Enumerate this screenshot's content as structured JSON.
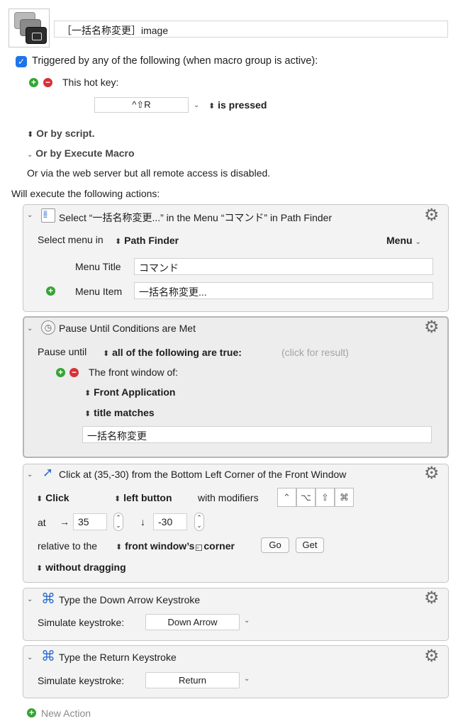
{
  "macro": {
    "name": "［一括名称変更］image",
    "trigger_checkbox_label": "Triggered by any of the following (when macro group is active):",
    "hotkey_label": "This hot key:",
    "hotkey_value": "^⇧R",
    "hotkey_state": "is pressed",
    "or_by_script": "Or by script.",
    "or_by_execute_macro": "Or by Execute Macro",
    "web_server_note": "Or via the web server but all remote access is disabled.",
    "will_execute": "Will execute the following actions:",
    "new_action": "New Action"
  },
  "actions": {
    "select_menu": {
      "title": "Select “一括名称変更...” in the Menu “コマンド” in Path Finder",
      "select_menu_in": "Select menu in",
      "app": "Path Finder",
      "menu_dropdown": "Menu",
      "menu_title_label": "Menu Title",
      "menu_title_value": "コマンド",
      "menu_item_label": "Menu Item",
      "menu_item_value": "一括名称変更..."
    },
    "pause": {
      "title": "Pause Until Conditions are Met",
      "pause_until": "Pause until",
      "condition_mode": "all of the following are true:",
      "click_for_result": "(click for result)",
      "front_window_of": "The front window of:",
      "front_application": "Front Application",
      "title_matches": "title matches",
      "title_value": "一括名称変更"
    },
    "click": {
      "title": "Click at (35,-30) from the Bottom Left Corner of the Front Window",
      "click_type": "Click",
      "button": "left button",
      "with_modifiers": "with modifiers",
      "modifiers": [
        "⌃",
        "⌥",
        "⇧",
        "⌘"
      ],
      "at_label": "at",
      "x_arrow": "→",
      "x_value": "35",
      "y_arrow": "↓",
      "y_value": "-30",
      "relative_to": "relative to the",
      "corner": "front window’s",
      "corner_suffix": "corner",
      "go_button": "Go",
      "get_button": "Get",
      "dragging": "without dragging"
    },
    "type_down": {
      "title": "Type the Down Arrow Keystroke",
      "simulate_label": "Simulate keystroke:",
      "key": "Down Arrow"
    },
    "type_return": {
      "title": "Type the Return Keystroke",
      "simulate_label": "Simulate keystroke:",
      "key": "Return"
    }
  },
  "colors": {
    "checkbox": "#1f74ea",
    "add": "#34a532",
    "remove": "#d8303a",
    "keystroke_icon": "#2f6fd3"
  },
  "icons": {
    "macro": "keyboard-keys-icon",
    "gear": "gear-icon",
    "menu": "menu-list-icon",
    "pause": "clock-icon",
    "click": "pointer-click-icon",
    "keystroke": "command-key-icon"
  }
}
